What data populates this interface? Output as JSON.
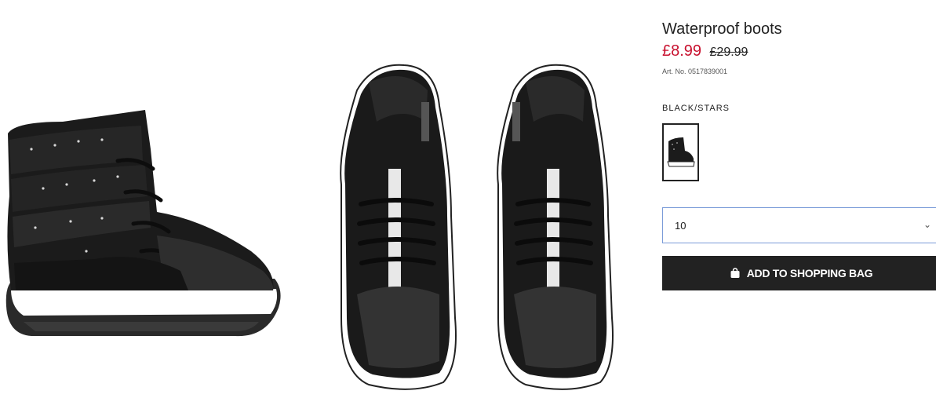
{
  "product": {
    "title": "Waterproof boots",
    "price_sale": "£8.99",
    "price_original": "£29.99",
    "article_number": "Art. No. 0517839001",
    "color_label": "BLACK/STARS",
    "selected_size": "10",
    "add_to_bag_label": "ADD TO SHOPPING BAG"
  },
  "colors": {
    "sale_price": "#c8102e",
    "button_bg": "#222222",
    "select_border": "#7a9bd8"
  },
  "icons": {
    "bag": "shopping-bag-icon",
    "select": "chevron-down-icon"
  }
}
